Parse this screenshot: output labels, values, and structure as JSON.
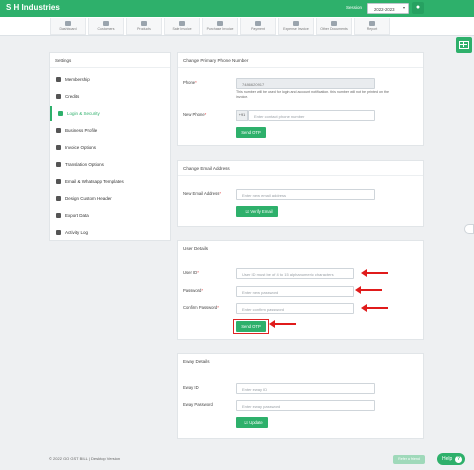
{
  "header": {
    "brand": "S H Industries",
    "session_label": "Session",
    "session_value": "2022-2023"
  },
  "nav": [
    "Dashboard",
    "Customers",
    "Products",
    "Sale Invoice",
    "Purchase Invoice",
    "Payment",
    "Expense Invoice",
    "Other Documents",
    "Report"
  ],
  "sidebar": {
    "title": "Settings",
    "items": [
      {
        "label": "Membership",
        "icon": "user-icon"
      },
      {
        "label": "Credits",
        "icon": "credit-icon"
      },
      {
        "label": "Login & Security",
        "icon": "lock-icon",
        "active": true
      },
      {
        "label": "Business Profile",
        "icon": "briefcase-icon"
      },
      {
        "label": "Invoice Options",
        "icon": "printer-icon"
      },
      {
        "label": "Translation Options",
        "icon": "translate-icon"
      },
      {
        "label": "Email & Whatsapp Templates",
        "icon": "envelope-icon"
      },
      {
        "label": "Design Custom Header",
        "icon": "image-icon"
      },
      {
        "label": "Export Data",
        "icon": "download-icon"
      },
      {
        "label": "Activity Log",
        "icon": "list-icon"
      }
    ]
  },
  "phone_card": {
    "title": "Change Primary Phone Number",
    "phone_label": "Phone",
    "phone_value": "7486620917",
    "help": "This number will be used for login and account notification. this number will not be printed on the invoice.",
    "new_phone_label": "New Phone",
    "prefix": "+91",
    "new_phone_placeholder": "Enter contact phone number",
    "button": "Send OTP"
  },
  "email_card": {
    "title": "Change Email Address",
    "label": "New Email Address",
    "placeholder": "Enter new email address",
    "button": "Verify Email"
  },
  "user_card": {
    "title": "User Details",
    "userid_label": "User ID",
    "userid_placeholder": "User ID must be of 4 to 15 alphanumeric characters",
    "password_label": "Password",
    "password_placeholder": "Enter new password",
    "confirm_label": "Confirm Password",
    "confirm_placeholder": "Enter confirm password",
    "button": "Send OTP"
  },
  "eway_card": {
    "title": "Eway Details",
    "id_label": "Eway ID",
    "id_placeholder": "Enter eway ID",
    "password_label": "Eway Password",
    "password_placeholder": "Enter eway password",
    "button": "Update"
  },
  "footer": {
    "text": "© 2022 GO GST BILL | Desktop Version",
    "refer": "Refer a friend",
    "help": "Help",
    "help_glyph": "?"
  },
  "colors": {
    "brand": "#2eb06b",
    "annotation": "#e01b1b"
  }
}
